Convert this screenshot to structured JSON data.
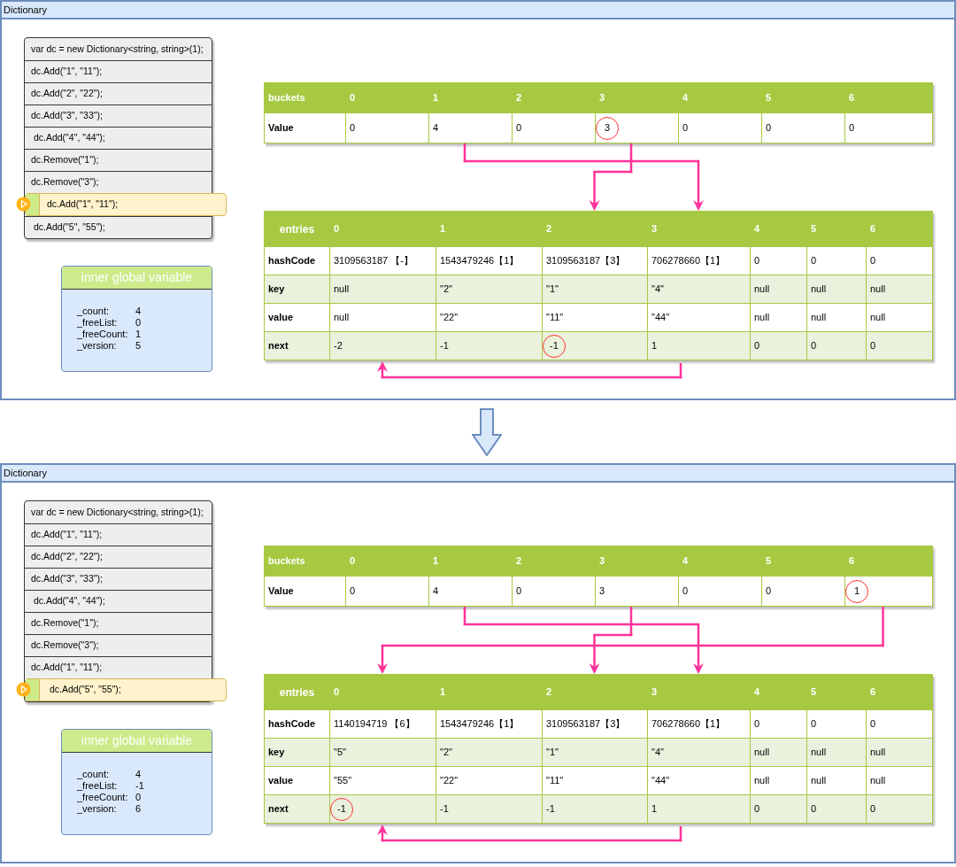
{
  "panels": [
    {
      "title": "Dictionary",
      "code_lines": [
        {
          "text": "var dc = new Dictionary<string, string>(1);",
          "selected": false
        },
        {
          "text": "dc.Add(\"1\", \"11\");",
          "selected": false
        },
        {
          "text": "dc.Add(\"2\", \"22\");",
          "selected": false
        },
        {
          "text": "dc.Add(\"3\", \"33\");",
          "selected": false
        },
        {
          "text": " dc.Add(\"4\", \"44\");",
          "selected": false
        },
        {
          "text": "dc.Remove(\"1\");",
          "selected": false
        },
        {
          "text": "dc.Remove(\"3\");",
          "selected": false
        },
        {
          "text": "dc.Add(\"1\", \"11\");",
          "selected": true
        },
        {
          "text": " dc.Add(\"5\", \"55\");",
          "selected": false
        }
      ],
      "globals": {
        "title": "inner global variable",
        "items": [
          {
            "name": "_count:",
            "value": "4"
          },
          {
            "name": "_freeList:",
            "value": "0"
          },
          {
            "name": "_freeCount:",
            "value": "1"
          },
          {
            "name": "_version:",
            "value": "5"
          }
        ]
      },
      "buckets": {
        "header": [
          "buckets",
          "0",
          "1",
          "2",
          "3",
          "4",
          "5",
          "6"
        ],
        "rows": [
          {
            "label": "Value",
            "cells": [
              {
                "text": "0",
                "circled": false
              },
              {
                "text": "4",
                "circled": false
              },
              {
                "text": "0",
                "circled": false
              },
              {
                "text": "3",
                "circled": true
              },
              {
                "text": "0",
                "circled": false
              },
              {
                "text": "0",
                "circled": false
              },
              {
                "text": "0",
                "circled": false
              }
            ]
          }
        ]
      },
      "entries": {
        "header": [
          "entries",
          "0",
          "1",
          "2",
          "3",
          "4",
          "5",
          "6"
        ],
        "rows": [
          {
            "label": "hashCode",
            "cells": [
              {
                "text": "3109563187 【-】",
                "circled": false
              },
              {
                "text": "1543479246【1】",
                "circled": false
              },
              {
                "text": "3109563187【3】",
                "circled": false
              },
              {
                "text": "706278660【1】",
                "circled": false
              },
              {
                "text": "0",
                "circled": false
              },
              {
                "text": "0",
                "circled": false
              },
              {
                "text": "0",
                "circled": false
              }
            ]
          },
          {
            "label": "key",
            "cells": [
              {
                "text": "null",
                "circled": false
              },
              {
                "text": "\"2\"",
                "circled": false
              },
              {
                "text": "\"1\"",
                "circled": false
              },
              {
                "text": "\"4\"",
                "circled": false
              },
              {
                "text": "null",
                "circled": false
              },
              {
                "text": "null",
                "circled": false
              },
              {
                "text": "null",
                "circled": false
              }
            ]
          },
          {
            "label": "value",
            "cells": [
              {
                "text": "null",
                "circled": false
              },
              {
                "text": "\"22\"",
                "circled": false
              },
              {
                "text": "\"11\"",
                "circled": false
              },
              {
                "text": "\"44\"",
                "circled": false
              },
              {
                "text": "null",
                "circled": false
              },
              {
                "text": "null",
                "circled": false
              },
              {
                "text": "null",
                "circled": false
              }
            ]
          },
          {
            "label": "next",
            "cells": [
              {
                "text": "-2",
                "circled": false
              },
              {
                "text": "-1",
                "circled": false
              },
              {
                "text": "-1",
                "circled": true
              },
              {
                "text": "1",
                "circled": false
              },
              {
                "text": "0",
                "circled": false
              },
              {
                "text": "0",
                "circled": false
              },
              {
                "text": "0",
                "circled": false
              }
            ]
          }
        ]
      }
    },
    {
      "title": "Dictionary",
      "code_lines": [
        {
          "text": "var dc = new Dictionary<string, string>(1);",
          "selected": false
        },
        {
          "text": "dc.Add(\"1\", \"11\");",
          "selected": false
        },
        {
          "text": "dc.Add(\"2\", \"22\");",
          "selected": false
        },
        {
          "text": "dc.Add(\"3\", \"33\");",
          "selected": false
        },
        {
          "text": " dc.Add(\"4\", \"44\");",
          "selected": false
        },
        {
          "text": "dc.Remove(\"1\");",
          "selected": false
        },
        {
          "text": "dc.Remove(\"3\");",
          "selected": false
        },
        {
          "text": "dc.Add(\"1\", \"11\");",
          "selected": false
        },
        {
          "text": " dc.Add(\"5\", \"55\");",
          "selected": true
        }
      ],
      "globals": {
        "title": "inner global variable",
        "items": [
          {
            "name": "_count:",
            "value": "4"
          },
          {
            "name": "_freeList:",
            "value": "-1"
          },
          {
            "name": "_freeCount:",
            "value": "0"
          },
          {
            "name": "_version:",
            "value": "6"
          }
        ]
      },
      "buckets": {
        "header": [
          "buckets",
          "0",
          "1",
          "2",
          "3",
          "4",
          "5",
          "6"
        ],
        "rows": [
          {
            "label": "Value",
            "cells": [
              {
                "text": "0",
                "circled": false
              },
              {
                "text": "4",
                "circled": false
              },
              {
                "text": "0",
                "circled": false
              },
              {
                "text": "3",
                "circled": false
              },
              {
                "text": "0",
                "circled": false
              },
              {
                "text": "0",
                "circled": false
              },
              {
                "text": "1",
                "circled": true
              }
            ]
          }
        ]
      },
      "entries": {
        "header": [
          "entries",
          "0",
          "1",
          "2",
          "3",
          "4",
          "5",
          "6"
        ],
        "rows": [
          {
            "label": "hashCode",
            "cells": [
              {
                "text": "1140194719 【6】",
                "circled": false
              },
              {
                "text": "1543479246【1】",
                "circled": false
              },
              {
                "text": "3109563187【3】",
                "circled": false
              },
              {
                "text": "706278660【1】",
                "circled": false
              },
              {
                "text": "0",
                "circled": false
              },
              {
                "text": "0",
                "circled": false
              },
              {
                "text": "0",
                "circled": false
              }
            ]
          },
          {
            "label": "key",
            "cells": [
              {
                "text": "\"5\"",
                "circled": false
              },
              {
                "text": "\"2\"",
                "circled": false
              },
              {
                "text": "\"1\"",
                "circled": false
              },
              {
                "text": "\"4\"",
                "circled": false
              },
              {
                "text": "null",
                "circled": false
              },
              {
                "text": "null",
                "circled": false
              },
              {
                "text": "null",
                "circled": false
              }
            ]
          },
          {
            "label": "value",
            "cells": [
              {
                "text": "\"55\"",
                "circled": false
              },
              {
                "text": "\"22\"",
                "circled": false
              },
              {
                "text": "\"11\"",
                "circled": false
              },
              {
                "text": "\"44\"",
                "circled": false
              },
              {
                "text": "null",
                "circled": false
              },
              {
                "text": "null",
                "circled": false
              },
              {
                "text": "null",
                "circled": false
              }
            ]
          },
          {
            "label": "next",
            "cells": [
              {
                "text": "-1",
                "circled": true
              },
              {
                "text": "-1",
                "circled": false
              },
              {
                "text": "-1",
                "circled": false
              },
              {
                "text": "1",
                "circled": false
              },
              {
                "text": "0",
                "circled": false
              },
              {
                "text": "0",
                "circled": false
              },
              {
                "text": "0",
                "circled": false
              }
            ]
          }
        ]
      }
    }
  ]
}
